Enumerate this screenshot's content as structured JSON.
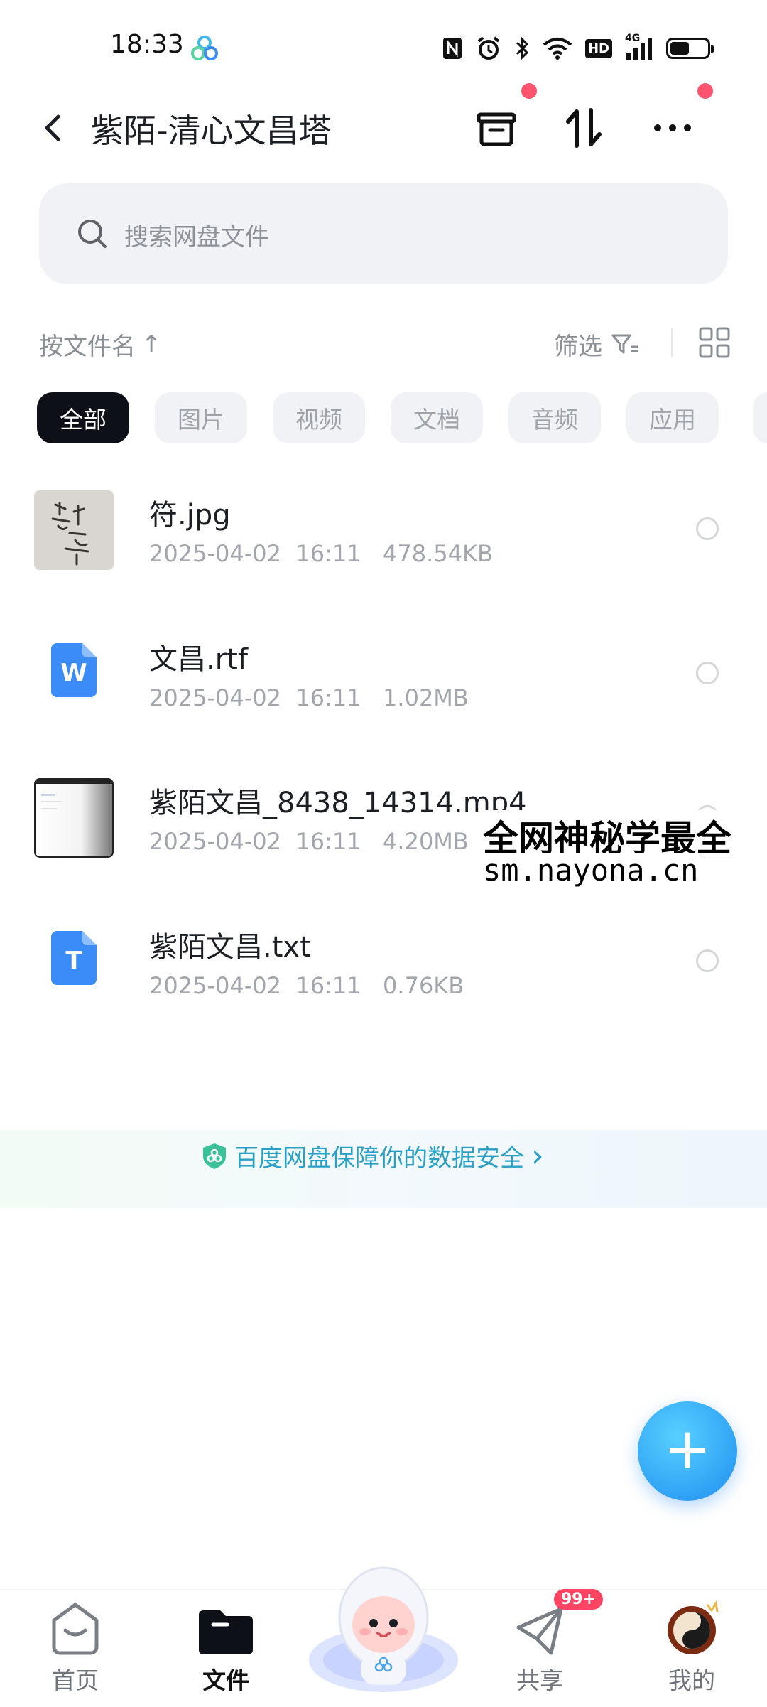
{
  "status_bar": {
    "time": "18:33",
    "icons": [
      "nfc-icon",
      "alarm-icon",
      "bluetooth-icon",
      "wifi-icon",
      "hd-icon",
      "signal-icon",
      "battery-icon"
    ],
    "hd_label": "HD",
    "network_label": "4G"
  },
  "header": {
    "title": "紫陌-清心文昌塔",
    "actions": [
      "archive-icon",
      "transfer-icon",
      "more-icon"
    ]
  },
  "search": {
    "placeholder": "搜索网盘文件"
  },
  "sort": {
    "label": "按文件名",
    "arrow": "↑",
    "filter_label": "筛选"
  },
  "tabs": [
    {
      "label": "全部"
    },
    {
      "label": "图片"
    },
    {
      "label": "视频"
    },
    {
      "label": "文档"
    },
    {
      "label": "音频"
    },
    {
      "label": "应用"
    }
  ],
  "files": [
    {
      "name": "符.jpg",
      "date": "2025-04-02",
      "time": "16:11",
      "size": "478.54KB",
      "type": "image"
    },
    {
      "name": "文昌.rtf",
      "date": "2025-04-02",
      "time": "16:11",
      "size": "1.02MB",
      "type": "word",
      "icon_letter": "W"
    },
    {
      "name": "紫陌文昌_8438_14314.mp4",
      "date": "2025-04-02",
      "time": "16:11",
      "size": "4.20MB",
      "type": "video"
    },
    {
      "name": "紫陌文昌.txt",
      "date": "2025-04-02",
      "time": "16:11",
      "size": "0.76KB",
      "type": "text",
      "icon_letter": "T"
    }
  ],
  "watermark": {
    "line1": "全网神秘学最全",
    "line2": "sm.nayona.cn"
  },
  "banner": {
    "text": "百度网盘保障你的数据安全",
    "chevron": "›"
  },
  "fab": {
    "label": "+"
  },
  "bottom_nav": [
    {
      "label": "首页",
      "icon": "home-icon"
    },
    {
      "label": "文件",
      "icon": "folder-icon",
      "active": true
    },
    {
      "label": "",
      "icon": "mascot-icon"
    },
    {
      "label": "共享",
      "icon": "share-icon",
      "badge": "99+"
    },
    {
      "label": "我的",
      "icon": "profile-avatar"
    }
  ],
  "colors": {
    "accent": "#1f8ef0",
    "dark": "#0d1117",
    "badge": "#ff4463",
    "banner_text": "#2aa0c4"
  }
}
